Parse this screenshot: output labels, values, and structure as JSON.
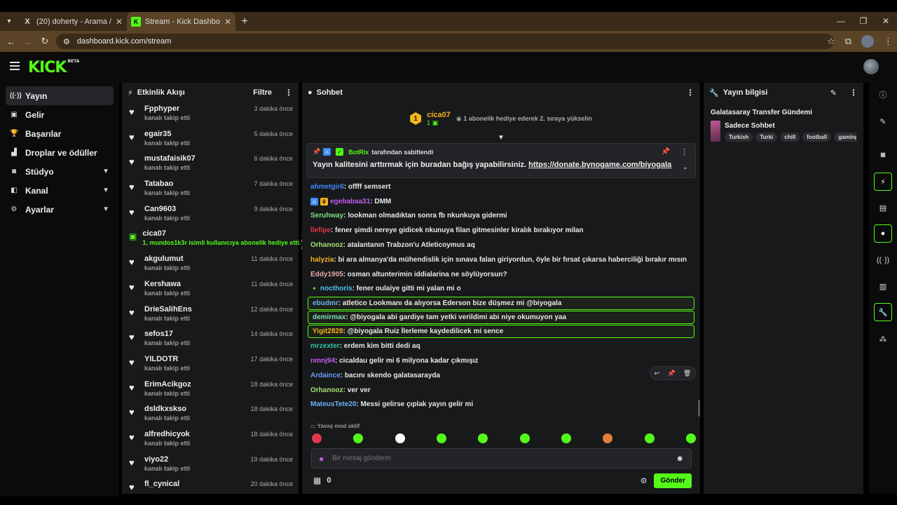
{
  "browser": {
    "tabs": [
      {
        "title": "(20) doherty - Arama / X",
        "icon": "X"
      },
      {
        "title": "Stream - Kick Dashboard",
        "icon": "K"
      }
    ],
    "url": "dashboard.kick.com/stream"
  },
  "header": {
    "logo": "KICK",
    "logo_badge": "BETA"
  },
  "nav": {
    "items": [
      {
        "label": "Yayın",
        "icon": "((·))"
      },
      {
        "label": "Gelir",
        "icon": "▣"
      },
      {
        "label": "Başarılar",
        "icon": "🏆"
      },
      {
        "label": "Droplar ve ödüller",
        "icon": "▟"
      },
      {
        "label": "Stüdyo",
        "icon": "◙"
      },
      {
        "label": "Kanal",
        "icon": "◧"
      },
      {
        "label": "Ayarlar",
        "icon": "⚙"
      }
    ]
  },
  "events": {
    "title": "Etkinlik Akışı",
    "filter_label": "Filtre",
    "items": [
      {
        "name": "Fpphyper",
        "sub": "kanalı takip etti",
        "time": "3 dakika önce"
      },
      {
        "name": "egair35",
        "sub": "kanalı takip etti",
        "time": "5 dakika önce"
      },
      {
        "name": "mustafaisik07",
        "sub": "kanalı takip etti",
        "time": "6 dakika önce"
      },
      {
        "name": "Tatabao",
        "sub": "kanalı takip etti",
        "time": "7 dakika önce"
      },
      {
        "name": "Can9603",
        "sub": "kanalı takip etti",
        "time": "9 dakika önce"
      },
      {
        "name": "cica07",
        "sub": "1, mundos1k3r isimli kullanıcıya abonelik hediye etti.",
        "time": "10 dakika önce"
      },
      {
        "name": "akgulumut",
        "sub": "kanalı takip etti",
        "time": "11 dakika önce"
      },
      {
        "name": "Kershawa",
        "sub": "kanalı takip etti",
        "time": "11 dakika önce"
      },
      {
        "name": "DrieSalihEns",
        "sub": "kanalı takip etti",
        "time": "12 dakika önce"
      },
      {
        "name": "sefos17",
        "sub": "kanalı takip etti",
        "time": "14 dakika önce"
      },
      {
        "name": "YILDOTR",
        "sub": "kanalı takip etti",
        "time": "17 dakika önce"
      },
      {
        "name": "ErimAcikgoz",
        "sub": "kanalı takip etti",
        "time": "18 dakika önce"
      },
      {
        "name": "dsldkxskso",
        "sub": "kanalı takip etti",
        "time": "18 dakika önce"
      },
      {
        "name": "alfredhicyok",
        "sub": "kanalı takip etti",
        "time": "18 dakika önce"
      },
      {
        "name": "viyo22",
        "sub": "kanalı takip etti",
        "time": "19 dakika önce"
      },
      {
        "name": "fl_cynical",
        "sub": "",
        "time": "20 dakika önce"
      }
    ]
  },
  "chat": {
    "title": "Sohbet",
    "sub_notice": {
      "badge": "1",
      "name": "cica07",
      "count": "1",
      "text": "1 abonelik hediye ederek 2. sıraya yükselin"
    },
    "pinned": {
      "by": "BotRix",
      "by_suffix": "tarafından sabitlendi",
      "message": "Yayın kalitesini arttırmak için buradan bağış yapabilirsiniz.",
      "link": "https://donate.bynogame.com/biyogala"
    },
    "messages": [
      {
        "user": "ahmetgir6",
        "text": ": offff semsert",
        "color": "#3d8af7"
      },
      {
        "user": "egebabaa31",
        "text": ": DMM",
        "color": "#c15cf0"
      },
      {
        "user": "Seruhway",
        "text": ": lookman olmadıktan sonra fb nkunkuya gidermi",
        "color": "#7ee07e"
      },
      {
        "user": "llefipe",
        "text": ": fener şimdi nereye gidicek nkunuya filan gitmesinler kiralık bırakıyor milan",
        "color": "#e0364a"
      },
      {
        "user": "Orhanooz",
        "text": ": atalantanın Trabzon'u Atleticoymus aq",
        "color": "#a8e06e"
      },
      {
        "user": "halyzia",
        "text": ": bi ara almanya'da mühendislik için sınava falan giriyordun, öyle bir fırsat çıkarsa haberciliği bırakır mısın",
        "color": "#f5b31c"
      },
      {
        "user": "Eddy1905",
        "text": ": osman altunterimin iddialarina ne söylüyorsun?",
        "color": "#e8a8a8"
      },
      {
        "user": "nocthoris",
        "text": ": fener oulaiye gitti mi yalan mi o",
        "color": "#4fc3f7"
      },
      {
        "user": "ebudmr",
        "text": ": atletico Lookmanı da alıyorsa Ederson bize düşmez mi @biyogala",
        "color": "#6ab0f3",
        "hl": true
      },
      {
        "user": "demirmax",
        "text": ": @biyogala abi gardiye tam yetki verildimi abi niye okumuyon yaa",
        "color": "#7ee0b8",
        "hl": true
      },
      {
        "user": "Yigit2828",
        "text": ": @biyogala Ruiz İlerleme kaydedilicek mi sence",
        "color": "#f5b31c",
        "hl": true
      },
      {
        "user": "mrzexter",
        "text": ": erdem kim bitti dedi aq",
        "color": "#2ec4a0"
      },
      {
        "user": "nmnj94",
        "text": ": cicaldau gelir mi 6 milyona kadar çıkmışız",
        "color": "#c15cf0"
      },
      {
        "user": "Ardaince",
        "text": ": bacını skendo galatasarayda",
        "color": "#6a9cf7"
      },
      {
        "user": "Orhanooz",
        "text": ": ver ver",
        "color": "#a8e06e"
      },
      {
        "user": "MateusTete20",
        "text": ": Messi gelirse çıplak yayın gelir mi",
        "color": "#6ab0f3"
      }
    ],
    "slow_mode": "Yavaş mod aktif",
    "input_placeholder": "Bir mesaj gönderin",
    "points": "0",
    "send_label": "Gönder",
    "emote_colors": [
      "#e0364a",
      "#53fc18",
      "#ffffff",
      "#53fc18",
      "#53fc18",
      "#53fc18",
      "#53fc18",
      "#e0803a",
      "#53fc18",
      "#53fc18"
    ]
  },
  "info": {
    "title": "Yayın bilgisi",
    "stream_title": "Galatasaray Transfer Gündemi",
    "category": "Sadece Sohbet",
    "tags": [
      "Turkish",
      "Turki",
      "chill",
      "football",
      "gaming"
    ]
  },
  "colors": {
    "accent": "#53fc18"
  }
}
